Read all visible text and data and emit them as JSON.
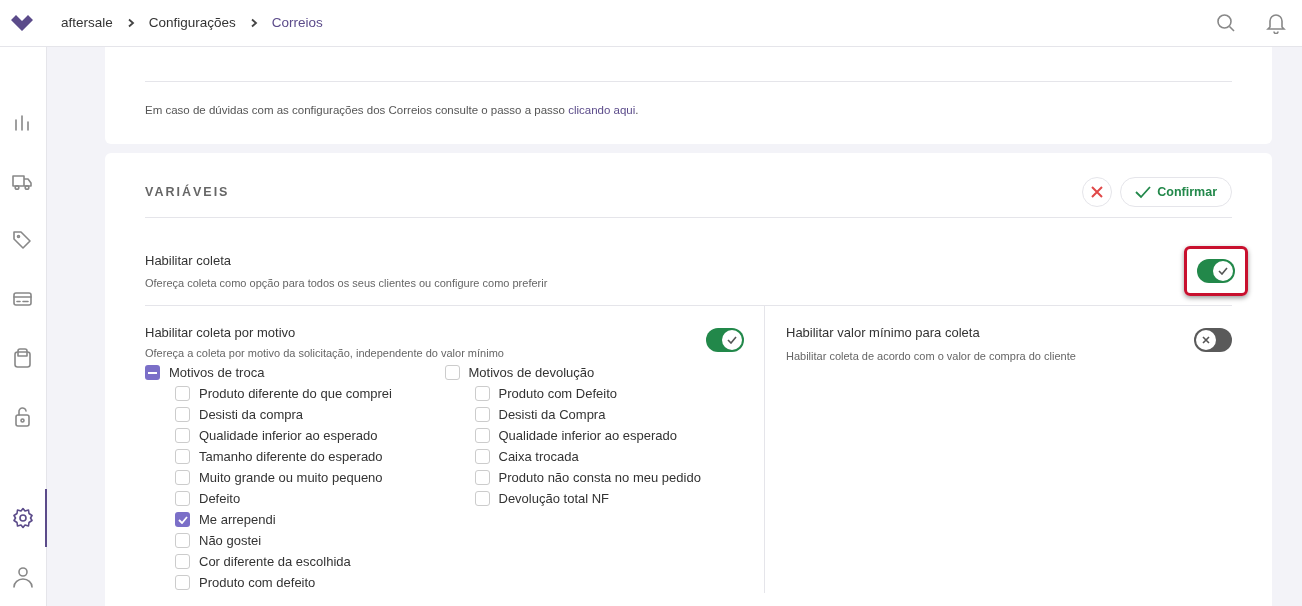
{
  "breadcrumb": [
    {
      "label": "aftersale",
      "current": false
    },
    {
      "label": "Configurações",
      "current": false
    },
    {
      "label": "Correios",
      "current": true
    }
  ],
  "sidebar": {
    "items": [
      {
        "selected": false
      },
      {
        "selected": false
      },
      {
        "selected": false
      },
      {
        "selected": false
      },
      {
        "selected": false
      },
      {
        "selected": false
      },
      {
        "selected": true
      },
      {
        "selected": false
      }
    ]
  },
  "help_text": {
    "text": "Em caso de dúvidas com as configurações dos Correios consulte o passo a passo ",
    "link": "clicando aqui",
    "after": "."
  },
  "variables": {
    "title": "VARIÁVEIS",
    "confirm_label": "Confirmar",
    "enable_pickup": {
      "label": "Habilitar coleta",
      "description": "Ofereça coleta como opção para todos os seus clientes ou configure como preferir",
      "on": true,
      "highlighted": true
    },
    "pickup_by_reason": {
      "label": "Habilitar coleta por motivo",
      "description": "Ofereça a coleta por motivo da solicitação, independente do valor mínimo",
      "on": true
    },
    "min_value": {
      "label": "Habilitar valor mínimo para coleta",
      "description": "Habilitar coleta de acordo com o valor de compra do cliente",
      "on": false
    },
    "reason_groups": [
      {
        "label": "Motivos de troca",
        "checked": false,
        "indeterminate": true,
        "items": [
          {
            "label": "Produto diferente do que comprei",
            "checked": false
          },
          {
            "label": "Desisti da compra",
            "checked": false
          },
          {
            "label": "Qualidade inferior ao esperado",
            "checked": false
          },
          {
            "label": "Tamanho diferente do esperado",
            "checked": false
          },
          {
            "label": "Muito grande ou muito pequeno",
            "checked": false
          },
          {
            "label": "Defeito",
            "checked": false
          },
          {
            "label": "Me arrependi",
            "checked": true
          },
          {
            "label": "Não gostei",
            "checked": false
          },
          {
            "label": "Cor diferente da escolhida",
            "checked": false
          },
          {
            "label": "Produto com defeito",
            "checked": false
          }
        ]
      },
      {
        "label": "Motivos de devolução",
        "checked": false,
        "indeterminate": false,
        "items": [
          {
            "label": "Produto com Defeito",
            "checked": false
          },
          {
            "label": "Desisti da Compra",
            "checked": false
          },
          {
            "label": "Qualidade inferior ao esperado",
            "checked": false
          },
          {
            "label": "Caixa trocada",
            "checked": false
          },
          {
            "label": "Produto não consta no meu pedido",
            "checked": false
          },
          {
            "label": "Devolução total NF",
            "checked": false
          }
        ]
      }
    ]
  }
}
